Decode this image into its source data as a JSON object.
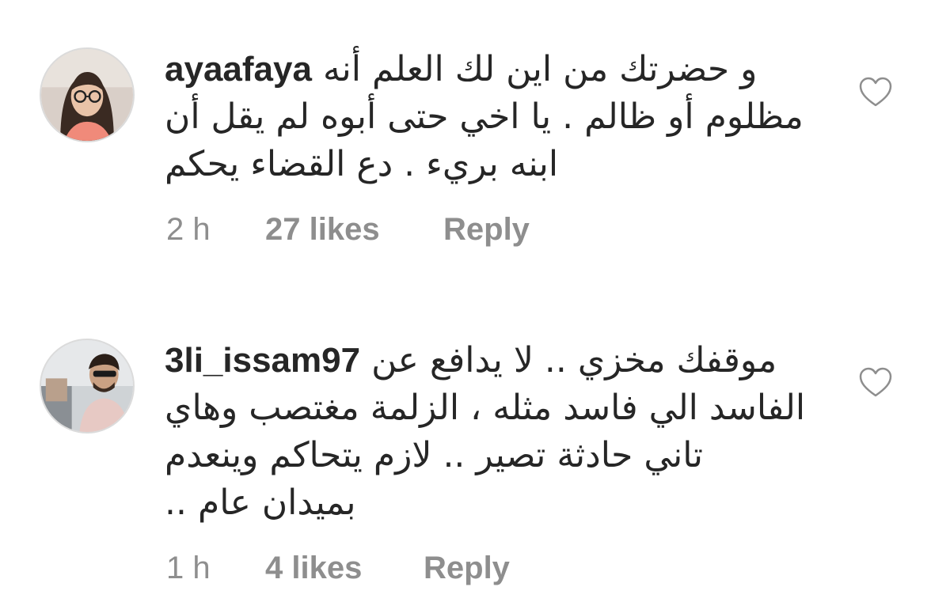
{
  "comments": [
    {
      "username": "ayaafaya",
      "lines": [
        "و حضرتك من اين لك العلم أنه",
        "مظلوم أو ظالم . يا اخي حتى أبوه لم يقل أن",
        "ابنه بريء . دع القضاء يحكم"
      ],
      "time": "2 h",
      "likes": "27 likes",
      "reply": "Reply",
      "like_icon": "heart-outline-icon"
    },
    {
      "username": "3li_issam97",
      "lines": [
        "موقفك مخزي .. لا يدافع عن",
        "الفاسد الي فاسد مثله ، الزلمة مغتصب وهاي",
        "تاني حادثة تصير .. لازم يتحاكم وينعدم",
        "بميدان عام .."
      ],
      "time": "1 h",
      "likes": "4 likes",
      "reply": "Reply",
      "like_icon": "heart-outline-icon"
    }
  ],
  "colors": {
    "text": "#262626",
    "meta": "#8e8e8e",
    "background": "#ffffff"
  }
}
